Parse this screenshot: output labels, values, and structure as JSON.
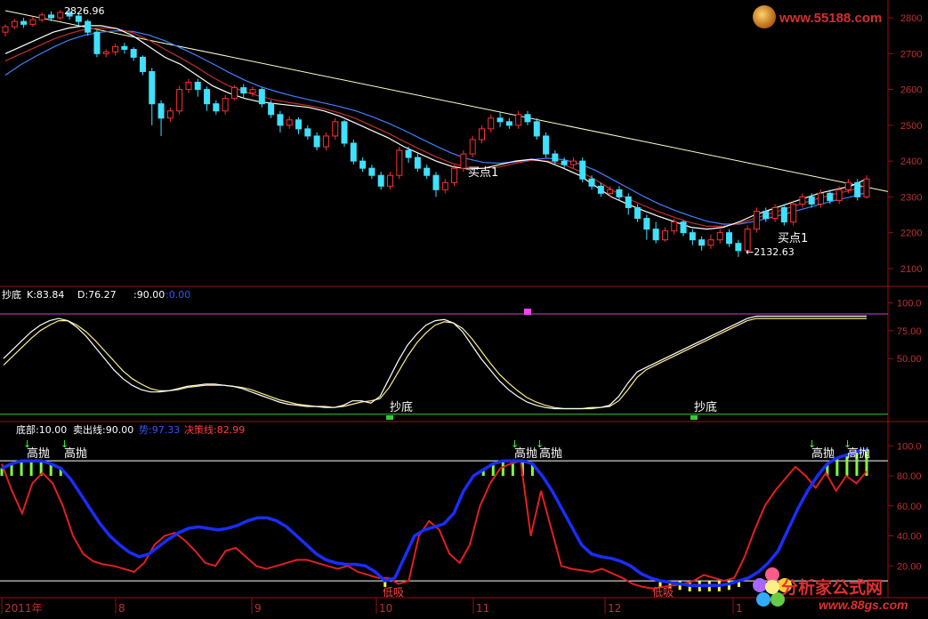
{
  "colors": {
    "up": "#ff3030",
    "down": "#40e0ff",
    "ma1": "#ffffff",
    "ma2": "#c0302a",
    "ma3": "#4080ff",
    "trend": "#ffffcc",
    "axis_frame": "#9a1010",
    "axis_text": "#c03030",
    "k_line": "#ffffff",
    "d_line": "#ffee88",
    "line90": "#cc44cc",
    "line0": "#33cc33",
    "blue_line": "#1a2dff",
    "red_line": "#e02020",
    "green_bar": "#80ff40",
    "yellow_bar": "#ffff40",
    "watermark": "#e03030"
  },
  "watermarks": {
    "top": "www.55188.com",
    "bottom_cn": "分析家公式网",
    "bottom_url": "www.88gs.com"
  },
  "chart_data": [
    {
      "type": "candlestick",
      "panel": "price",
      "ylim": [
        2060,
        2830
      ],
      "yticks": [
        "2800",
        "2700",
        "2600",
        "2500",
        "2400",
        "2300",
        "2200",
        "2100"
      ],
      "annotations": {
        "high": "2826.96",
        "low": "←2132.63",
        "buy1": "买点1",
        "buy2": "买点1"
      },
      "candles": [
        [
          2760,
          2775,
          2748,
          2782
        ],
        [
          2775,
          2790,
          2768,
          2797
        ],
        [
          2790,
          2782,
          2772,
          2800
        ],
        [
          2782,
          2795,
          2775,
          2803
        ],
        [
          2795,
          2808,
          2788,
          2815
        ],
        [
          2808,
          2800,
          2790,
          2818
        ],
        [
          2800,
          2815,
          2794,
          2822
        ],
        [
          2815,
          2805,
          2795,
          2826.96
        ],
        [
          2805,
          2790,
          2780,
          2812
        ],
        [
          2790,
          2760,
          2750,
          2795
        ],
        [
          2760,
          2700,
          2690,
          2765
        ],
        [
          2700,
          2705,
          2690,
          2712
        ],
        [
          2705,
          2720,
          2695,
          2728
        ],
        [
          2720,
          2712,
          2700,
          2730
        ],
        [
          2712,
          2690,
          2680,
          2718
        ],
        [
          2690,
          2650,
          2640,
          2695
        ],
        [
          2650,
          2560,
          2500,
          2660
        ],
        [
          2560,
          2520,
          2470,
          2570
        ],
        [
          2520,
          2540,
          2510,
          2550
        ],
        [
          2540,
          2600,
          2530,
          2610
        ],
        [
          2600,
          2620,
          2590,
          2630
        ],
        [
          2620,
          2600,
          2580,
          2630
        ],
        [
          2600,
          2560,
          2540,
          2608
        ],
        [
          2560,
          2540,
          2530,
          2570
        ],
        [
          2540,
          2575,
          2530,
          2585
        ],
        [
          2575,
          2605,
          2570,
          2612
        ],
        [
          2605,
          2590,
          2575,
          2615
        ],
        [
          2590,
          2600,
          2580,
          2608
        ],
        [
          2600,
          2560,
          2550,
          2605
        ],
        [
          2560,
          2530,
          2520,
          2570
        ],
        [
          2530,
          2500,
          2480,
          2540
        ],
        [
          2500,
          2515,
          2490,
          2525
        ],
        [
          2515,
          2490,
          2475,
          2522
        ],
        [
          2490,
          2470,
          2460,
          2500
        ],
        [
          2470,
          2440,
          2430,
          2480
        ],
        [
          2440,
          2470,
          2430,
          2480
        ],
        [
          2470,
          2510,
          2460,
          2520
        ],
        [
          2510,
          2450,
          2440,
          2515
        ],
        [
          2450,
          2400,
          2390,
          2460
        ],
        [
          2400,
          2380,
          2370,
          2410
        ],
        [
          2380,
          2360,
          2350,
          2390
        ],
        [
          2360,
          2330,
          2320,
          2370
        ],
        [
          2330,
          2360,
          2320,
          2370
        ],
        [
          2360,
          2430,
          2350,
          2440
        ],
        [
          2430,
          2410,
          2395,
          2440
        ],
        [
          2410,
          2380,
          2370,
          2420
        ],
        [
          2380,
          2360,
          2350,
          2390
        ],
        [
          2360,
          2320,
          2300,
          2370
        ],
        [
          2320,
          2340,
          2310,
          2350
        ],
        [
          2340,
          2380,
          2330,
          2390
        ],
        [
          2380,
          2420,
          2370,
          2430
        ],
        [
          2420,
          2460,
          2410,
          2470
        ],
        [
          2460,
          2490,
          2450,
          2500
        ],
        [
          2490,
          2520,
          2480,
          2530
        ],
        [
          2520,
          2510,
          2495,
          2535
        ],
        [
          2510,
          2500,
          2490,
          2520
        ],
        [
          2500,
          2530,
          2490,
          2540
        ],
        [
          2530,
          2510,
          2500,
          2540
        ],
        [
          2510,
          2470,
          2460,
          2520
        ],
        [
          2470,
          2420,
          2410,
          2480
        ],
        [
          2420,
          2400,
          2390,
          2430
        ],
        [
          2400,
          2390,
          2380,
          2410
        ],
        [
          2390,
          2400,
          2380,
          2410
        ],
        [
          2400,
          2350,
          2340,
          2410
        ],
        [
          2350,
          2330,
          2320,
          2360
        ],
        [
          2330,
          2310,
          2300,
          2340
        ],
        [
          2310,
          2320,
          2300,
          2330
        ],
        [
          2320,
          2300,
          2290,
          2330
        ],
        [
          2300,
          2270,
          2250,
          2310
        ],
        [
          2270,
          2240,
          2230,
          2280
        ],
        [
          2240,
          2210,
          2180,
          2250
        ],
        [
          2210,
          2180,
          2170,
          2230
        ],
        [
          2180,
          2205,
          2175,
          2215
        ],
        [
          2205,
          2230,
          2195,
          2240
        ],
        [
          2230,
          2200,
          2190,
          2235
        ],
        [
          2200,
          2180,
          2165,
          2210
        ],
        [
          2180,
          2165,
          2150,
          2190
        ],
        [
          2165,
          2180,
          2155,
          2195
        ],
        [
          2180,
          2200,
          2170,
          2210
        ],
        [
          2200,
          2170,
          2160,
          2210
        ],
        [
          2170,
          2150,
          2132.63,
          2180
        ],
        [
          2150,
          2210,
          2145,
          2220
        ],
        [
          2210,
          2260,
          2200,
          2270
        ],
        [
          2260,
          2240,
          2230,
          2270
        ],
        [
          2240,
          2270,
          2230,
          2280
        ],
        [
          2270,
          2230,
          2220,
          2280
        ],
        [
          2230,
          2280,
          2220,
          2290
        ],
        [
          2280,
          2300,
          2270,
          2310
        ],
        [
          2300,
          2280,
          2270,
          2310
        ],
        [
          2280,
          2310,
          2270,
          2320
        ],
        [
          2310,
          2290,
          2280,
          2320
        ],
        [
          2290,
          2320,
          2280,
          2330
        ],
        [
          2320,
          2340,
          2310,
          2350
        ],
        [
          2340,
          2300,
          2290,
          2350
        ],
        [
          2300,
          2350,
          2295,
          2360
        ]
      ],
      "moving_averages": {
        "ma1": [
          2700,
          2720,
          2740,
          2760,
          2772,
          2778,
          2778,
          2770,
          2750,
          2720,
          2690,
          2670,
          2640,
          2610,
          2590,
          2575,
          2565,
          2560,
          2555,
          2550,
          2540,
          2525,
          2505,
          2485,
          2465,
          2440,
          2420,
          2400,
          2385,
          2378,
          2380,
          2390,
          2400,
          2405,
          2398,
          2380,
          2360,
          2330,
          2300,
          2280,
          2262,
          2245,
          2230,
          2215,
          2210,
          2215,
          2230,
          2250,
          2265,
          2280,
          2295,
          2310,
          2320,
          2330,
          2350
        ],
        "ma2": [
          2680,
          2700,
          2720,
          2740,
          2756,
          2768,
          2772,
          2770,
          2758,
          2738,
          2712,
          2688,
          2662,
          2634,
          2610,
          2594,
          2580,
          2570,
          2562,
          2555,
          2546,
          2534,
          2518,
          2498,
          2478,
          2455,
          2433,
          2412,
          2394,
          2382,
          2380,
          2384,
          2394,
          2402,
          2400,
          2390,
          2372,
          2348,
          2320,
          2296,
          2276,
          2258,
          2242,
          2228,
          2218,
          2218,
          2226,
          2240,
          2254,
          2268,
          2282,
          2296,
          2308,
          2318,
          2332
        ],
        "ma3": [
          2640,
          2670,
          2695,
          2718,
          2738,
          2752,
          2760,
          2764,
          2762,
          2752,
          2736,
          2716,
          2695,
          2672,
          2648,
          2626,
          2608,
          2594,
          2582,
          2572,
          2562,
          2552,
          2540,
          2524,
          2506,
          2486,
          2464,
          2442,
          2422,
          2406,
          2396,
          2394,
          2398,
          2404,
          2408,
          2404,
          2392,
          2374,
          2350,
          2326,
          2302,
          2280,
          2262,
          2246,
          2232,
          2224,
          2224,
          2232,
          2242,
          2254,
          2266,
          2278,
          2290,
          2300,
          2312
        ],
        "ma_x_start": 0,
        "ma_x_end": 94
      },
      "trendline": [
        [
          0,
          2820
        ],
        [
          94,
          2315
        ]
      ]
    },
    {
      "type": "line",
      "panel": "kd",
      "header": {
        "name": "抄底",
        "k": "K:83.84",
        "d": "D:76.27",
        "l90": ":90.00",
        "l0": ":0.00"
      },
      "ylim": [
        -5,
        110
      ],
      "yticks": [
        "100.0",
        "75.00",
        "50.00"
      ],
      "levels": [
        90,
        0
      ],
      "labels": [
        "抄底",
        "抄底"
      ],
      "K": [
        50,
        58,
        66,
        74,
        80,
        84,
        86,
        84,
        78,
        70,
        60,
        50,
        40,
        32,
        26,
        22,
        20,
        20,
        21,
        23,
        25,
        26,
        27,
        27,
        26,
        25,
        23,
        20,
        17,
        14,
        11,
        9,
        8,
        7,
        7,
        6,
        6,
        8,
        12,
        12,
        10,
        16,
        32,
        48,
        62,
        72,
        80,
        84,
        85,
        82,
        74,
        62,
        50,
        40,
        30,
        22,
        16,
        11,
        8,
        6,
        5,
        5,
        5,
        5,
        6,
        6,
        8,
        16,
        28,
        38,
        42,
        46,
        50,
        54,
        58,
        62,
        66,
        70,
        74,
        78,
        82,
        86,
        88,
        88,
        88,
        88,
        88,
        88,
        88,
        88,
        88,
        88,
        88,
        88,
        88
      ],
      "D": [
        44,
        52,
        60,
        68,
        75,
        80,
        84,
        84,
        80,
        74,
        66,
        57,
        48,
        39,
        32,
        27,
        23,
        21,
        21,
        22,
        24,
        25,
        26,
        26,
        26,
        25,
        24,
        22,
        19,
        16,
        13,
        11,
        9,
        8,
        7,
        7,
        6,
        7,
        9,
        11,
        12,
        14,
        24,
        38,
        52,
        64,
        73,
        80,
        83,
        82,
        77,
        68,
        57,
        46,
        36,
        28,
        21,
        15,
        11,
        8,
        6,
        5,
        5,
        5,
        5,
        6,
        7,
        12,
        22,
        33,
        40,
        44,
        48,
        52,
        56,
        60,
        64,
        68,
        72,
        76,
        80,
        84,
        86,
        86,
        86,
        86,
        86,
        86,
        86,
        86,
        86,
        86,
        86,
        86,
        86
      ]
    },
    {
      "type": "line",
      "panel": "signal",
      "header": {
        "bottom": "底部:10.00",
        "sell": "卖出线:90.00",
        "trend": "势:97.33",
        "decision": "决策线:82.99"
      },
      "ylim": [
        0,
        115
      ],
      "yticks": [
        "100.0",
        "80.00",
        "60.00",
        "40.00",
        "20.00"
      ],
      "levels": [
        90,
        10
      ],
      "labels": {
        "sell": "高抛",
        "buy": "低吸"
      },
      "sell_x": [
        4,
        10,
        73,
        77,
        118,
        122
      ],
      "buy_x": [
        54,
        93
      ],
      "blue": [
        85,
        88,
        90,
        90,
        90,
        88,
        85,
        78,
        68,
        58,
        48,
        40,
        34,
        29,
        26,
        28,
        33,
        38,
        42,
        45,
        46,
        45,
        44,
        45,
        47,
        50,
        52,
        52,
        50,
        46,
        40,
        34,
        28,
        24,
        22,
        21,
        21,
        20,
        16,
        10,
        12,
        26,
        40,
        44,
        46,
        48,
        55,
        70,
        80,
        84,
        88,
        90,
        90,
        90,
        88,
        80,
        70,
        58,
        46,
        34,
        28,
        26,
        25,
        23,
        20,
        15,
        12,
        10,
        9,
        8,
        7,
        7,
        7,
        7,
        8,
        10,
        12,
        16,
        22,
        30,
        44,
        58,
        70,
        80,
        88,
        92,
        94,
        96,
        97.33
      ],
      "red": [
        88,
        70,
        55,
        75,
        82,
        75,
        60,
        40,
        28,
        23,
        21,
        20,
        18,
        16,
        22,
        34,
        40,
        42,
        37,
        30,
        22,
        20,
        30,
        32,
        26,
        20,
        18,
        20,
        22,
        24,
        24,
        22,
        20,
        18,
        20,
        16,
        14,
        12,
        12,
        8,
        10,
        40,
        50,
        44,
        28,
        22,
        34,
        60,
        75,
        85,
        88,
        90,
        40,
        70,
        45,
        20,
        18,
        17,
        16,
        18,
        15,
        12,
        8,
        6,
        5,
        6,
        7,
        8,
        10,
        14,
        12,
        10,
        12,
        26,
        44,
        60,
        70,
        78,
        86,
        80,
        72,
        82,
        70,
        80,
        75,
        82.99
      ]
    }
  ],
  "x_axis": {
    "labels": [
      "2011年",
      "8",
      "9",
      "10",
      "11",
      "12",
      "1"
    ]
  }
}
